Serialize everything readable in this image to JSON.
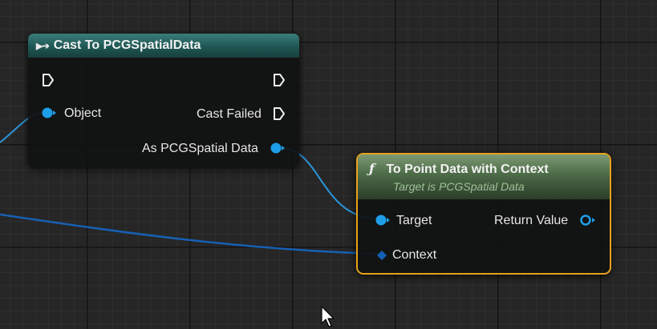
{
  "cast_node": {
    "title": "Cast To PCGSpatialData",
    "object_label": "Object",
    "cast_failed_label": "Cast Failed",
    "output_label": "As PCGSpatial Data"
  },
  "to_point_node": {
    "title": "To Point Data with Context",
    "subtitle": "Target is PCGSpatial Data",
    "target_label": "Target",
    "context_label": "Context",
    "return_label": "Return Value"
  },
  "colors": {
    "object_pin": "#1e9ee8",
    "struct_pin": "#1560b5",
    "selection_outline": "#e7a21b",
    "cast_header": "#1f5754",
    "function_header": "#4c6a47"
  },
  "icons": {
    "exec_pin": "exec-arrow-icon",
    "function": "function-icon",
    "cursor": "mouse-pointer-icon"
  }
}
